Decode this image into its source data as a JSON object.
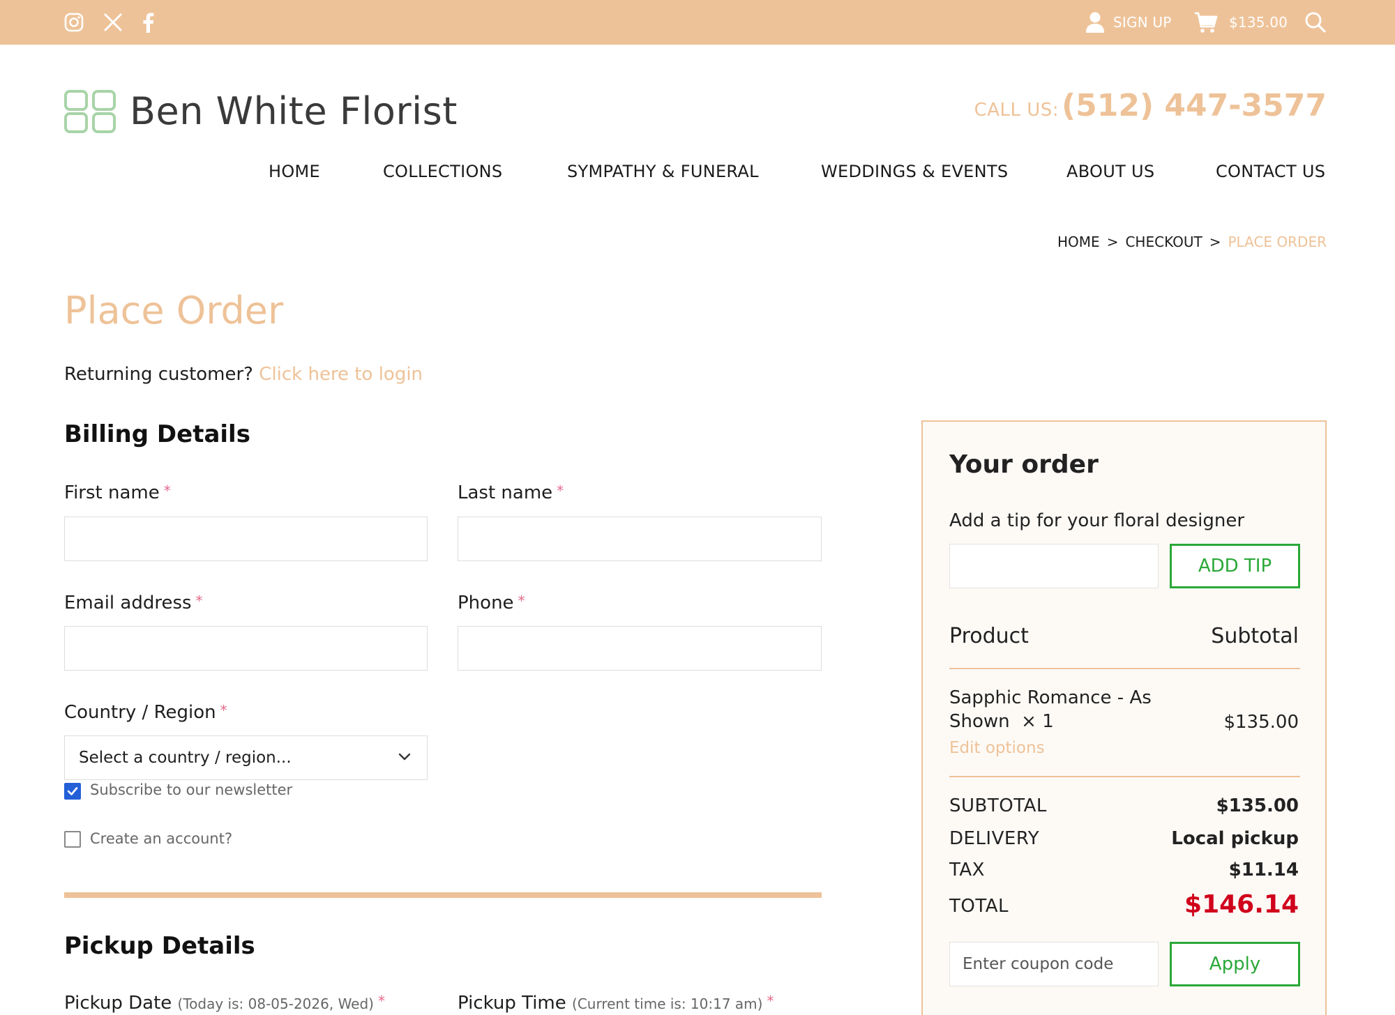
{
  "topbar": {
    "social": [
      "instagram-icon",
      "x-icon",
      "facebook-icon"
    ],
    "signup_label": "SIGN UP",
    "cart_total": "$135.00"
  },
  "brand": {
    "name": "Ben White Florist",
    "call_label": "CALL US:",
    "phone": "(512) 447-3577"
  },
  "nav": [
    "HOME",
    "COLLECTIONS",
    "SYMPATHY & FUNERAL",
    "WEDDINGS & EVENTS",
    "ABOUT US",
    "CONTACT US"
  ],
  "breadcrumb": {
    "items": [
      "HOME",
      "CHECKOUT",
      "PLACE ORDER"
    ],
    "separator": ">"
  },
  "page": {
    "title": "Place Order",
    "returning_text": "Returning customer?",
    "login_link": "Click here to login"
  },
  "billing": {
    "title": "Billing Details",
    "required_mark": "*",
    "first_name_label": "First name",
    "last_name_label": "Last name",
    "email_label": "Email address",
    "phone_label": "Phone",
    "country_label": "Country / Region",
    "country_value": "Select a country / region...",
    "newsletter_label": "Subscribe to our newsletter",
    "newsletter_checked": true,
    "create_account_label": "Create an account?",
    "create_account_checked": false
  },
  "pickup": {
    "title": "Pickup Details",
    "date_label": "Pickup Date",
    "date_hint": "(Today is: 08-05-2026, Wed)",
    "time_label": "Pickup Time",
    "time_hint": "(Current time is: 10:17 am)"
  },
  "order": {
    "title": "Your order",
    "tip_label": "Add a tip for your floral designer",
    "tip_button": "ADD TIP",
    "col_product": "Product",
    "col_subtotal": "Subtotal",
    "item": {
      "name": "Sapphic Romance - As Shown",
      "qty": "× 1",
      "price": "$135.00",
      "edit_link": "Edit options"
    },
    "totals": {
      "subtotal_label": "SUBTOTAL",
      "subtotal_value": "$135.00",
      "delivery_label": "DELIVERY",
      "delivery_value": "Local pickup",
      "tax_label": "TAX",
      "tax_value": "$11.14",
      "total_label": "TOTAL",
      "total_value": "$146.14"
    },
    "coupon_placeholder": "Enter coupon code",
    "apply_button": "Apply"
  },
  "colors": {
    "accent": "#eec298",
    "button_green": "#2aa838",
    "total_red": "#d0021b",
    "logo_green": "#a8d4a8"
  }
}
